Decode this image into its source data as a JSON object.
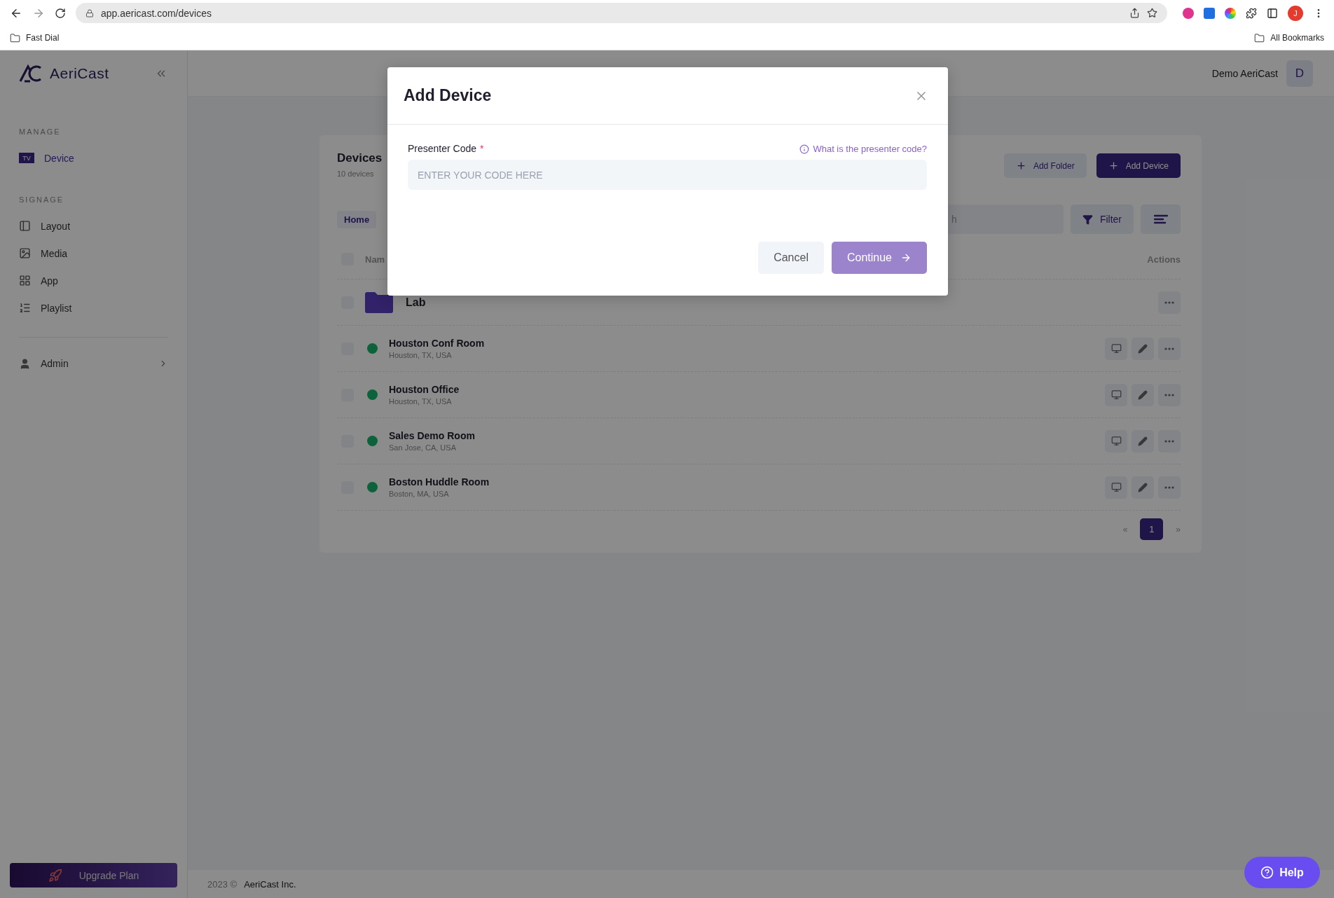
{
  "browser": {
    "url": "app.aericast.com/devices",
    "bookmarks": [
      "Fast Dial"
    ],
    "all_bookmarks": "All Bookmarks",
    "profile_initial": "J"
  },
  "sidebar": {
    "brand": "AeriCast",
    "sections": [
      {
        "title": "MANAGE",
        "items": [
          {
            "label": "Device",
            "badge": "TV",
            "selected": true
          }
        ]
      },
      {
        "title": "SIGNAGE",
        "items": [
          {
            "label": "Layout",
            "selected": false
          },
          {
            "label": "Media",
            "selected": false
          },
          {
            "label": "App",
            "selected": false
          },
          {
            "label": "Playlist",
            "selected": false
          }
        ]
      }
    ],
    "admin": "Admin",
    "upgrade": "Upgrade Plan"
  },
  "topbar": {
    "user": "Demo AeriCast",
    "avatar": "D"
  },
  "page": {
    "title": "Devices",
    "subtitle": "10 devices",
    "buttons": [
      {
        "label": "Add Folder",
        "kind": "secondary"
      },
      {
        "label": "Add Device",
        "kind": "primary"
      }
    ],
    "breadcrumb": "Home",
    "search": {
      "placeholder": "h"
    },
    "filter": "Filter"
  },
  "table": {
    "select_all_checked": false,
    "columns": [
      "Nam",
      "Actions"
    ],
    "rows": [
      {
        "kind": "folder",
        "name": "Lab",
        "checked": false
      },
      {
        "kind": "device",
        "name": "Houston Conf Room",
        "location": "Houston, TX, USA",
        "online": true,
        "checked": false
      },
      {
        "kind": "device",
        "name": "Houston Office",
        "location": "Houston, TX, USA",
        "online": true,
        "checked": false
      },
      {
        "kind": "device",
        "name": "Sales Demo Room",
        "location": "San Jose, CA, USA",
        "online": true,
        "checked": false
      },
      {
        "kind": "device",
        "name": "Boston Huddle Room",
        "location": "Boston, MA, USA",
        "online": true,
        "checked": false
      }
    ]
  },
  "pagination": {
    "prev": "«",
    "pages": [
      {
        "label": "1",
        "selected": true
      }
    ],
    "next": "»"
  },
  "footer": {
    "year": "2023 ©",
    "company": "AeriCast Inc."
  },
  "help": "Help",
  "modal": {
    "title": "Add Device",
    "field": {
      "label": "Presenter Code",
      "required_mark": "*",
      "help_link": "What is the presenter code?",
      "placeholder": "ENTER YOUR CODE HERE"
    },
    "buttons": [
      {
        "label": "Cancel",
        "kind": "secondary",
        "disabled": false
      },
      {
        "label": "Continue",
        "kind": "primary",
        "disabled": true
      }
    ]
  }
}
